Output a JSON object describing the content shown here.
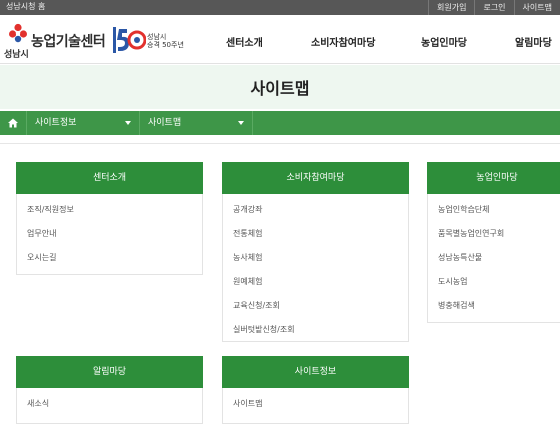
{
  "util": {
    "home_link": "성남시청 홈",
    "links": [
      "회원가입",
      "로그인",
      "사이트맵"
    ]
  },
  "logo": {
    "city": "성남시",
    "name": "농업기술센터",
    "badge_line1": "성남시",
    "badge_line2": "승격 50주년"
  },
  "gnb": [
    "센터소개",
    "소비자참여마당",
    "농업인마당",
    "알림마당"
  ],
  "page_title": "사이트맵",
  "breadcrumb": [
    "사이트정보",
    "사이트맵"
  ],
  "sections": [
    {
      "title": "센터소개",
      "items": [
        "조직/직원정보",
        "업무안내",
        "오시는길"
      ]
    },
    {
      "title": "소비자참여마당",
      "items": [
        "공개강좌",
        "전통체험",
        "농사체험",
        "원예체험",
        "교육신청/조회",
        "실버텃밭신청/조회"
      ]
    },
    {
      "title": "농업인마당",
      "items": [
        "농업인학습단체",
        "품목별농업인연구회",
        "성남농특산물",
        "도시농업",
        "병충해검색"
      ]
    },
    {
      "title": "알림마당",
      "items": [
        "새소식"
      ]
    },
    {
      "title": "사이트정보",
      "items": [
        "사이트맵"
      ]
    }
  ],
  "colors": {
    "primary_green": "#2d8e3a",
    "breadcrumb_green": "#3e9648",
    "band": "#eef7f0"
  }
}
